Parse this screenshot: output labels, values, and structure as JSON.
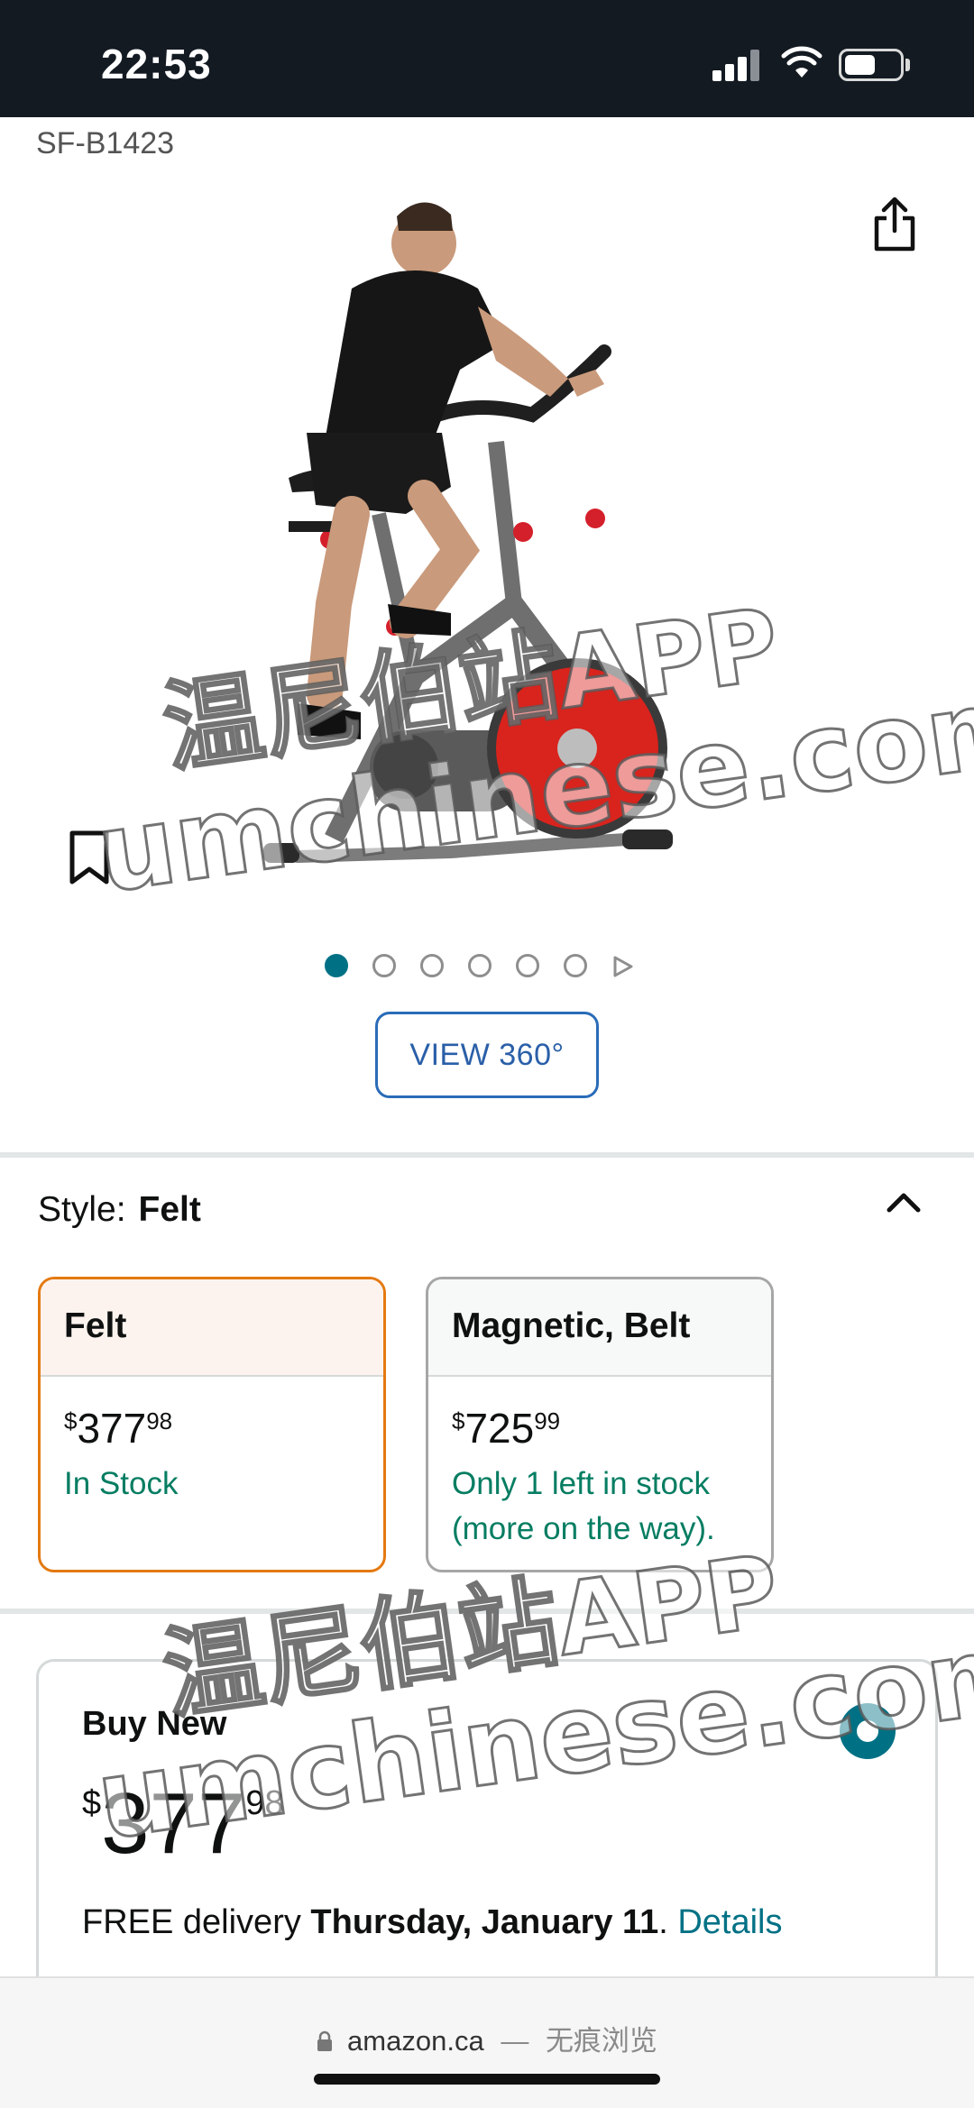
{
  "status_bar": {
    "time": "22:53",
    "battery_level": 0.55
  },
  "product": {
    "model_code": "SF-B1423",
    "image_alt": "Indoor cycling bike with rider",
    "image_count": 6,
    "active_image_index": 0,
    "view360_label": "VIEW 360°"
  },
  "style_selector": {
    "label": "Style:",
    "selected": "Felt",
    "options": [
      {
        "name": "Felt",
        "price_whole": "377",
        "price_fraction": "98",
        "currency_symbol": "$",
        "stock": "In Stock",
        "selected": true
      },
      {
        "name": "Magnetic, Belt",
        "price_whole": "725",
        "price_fraction": "99",
        "currency_symbol": "$",
        "stock": "Only 1 left in stock (more on the way).",
        "selected": false
      }
    ]
  },
  "buy_box": {
    "title": "Buy New",
    "currency_symbol": "$",
    "price_whole": "377",
    "price_fraction": "98",
    "delivery_prefix": "FREE delivery",
    "delivery_date": "Thursday, January 11",
    "delivery_suffix": ".",
    "details_link": "Details"
  },
  "browser": {
    "domain": "amazon.ca",
    "separator": "—",
    "private_label": "无痕浏览"
  },
  "watermark": {
    "line1": "温尼伯站APP",
    "line2": "umchinese.com"
  },
  "colors": {
    "accent_teal": "#007185",
    "selected_border": "#e47911",
    "stock_green": "#067d62",
    "status_bar": "#131a22"
  }
}
